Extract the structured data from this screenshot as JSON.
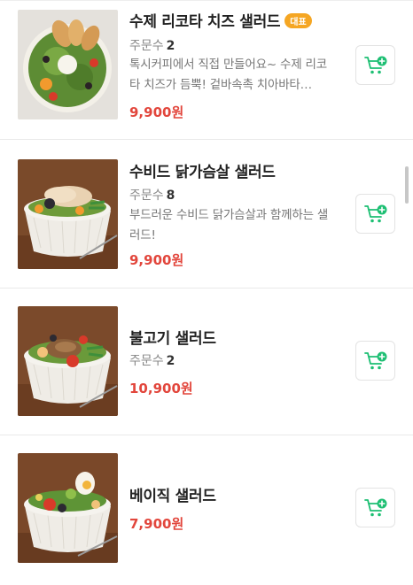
{
  "menu": {
    "order_count_label": "주문수",
    "items": [
      {
        "name": "수제 리코타 치즈 샐러드",
        "badge": "대표",
        "order_count": "2",
        "description": "톡시커피에서 직접 만들어요~ 수제 리코타 치즈가 듬뿍! 겉바속촉 치아바타…",
        "price": "9,900원",
        "image": "ricotta-salad-photo"
      },
      {
        "name": "수비드 닭가슴살 샐러드",
        "order_count": "8",
        "description": "부드러운 수비드 닭가슴살과 함께하는 샐러드!",
        "price": "9,900원",
        "image": "chicken-salad-photo"
      },
      {
        "name": "불고기 샐러드",
        "order_count": "2",
        "price": "10,900원",
        "image": "bulgogi-salad-photo"
      },
      {
        "name": "베이직 샐러드",
        "price": "7,900원",
        "image": "basic-salad-photo"
      }
    ],
    "cart_icon": "add-to-cart-icon"
  },
  "colors": {
    "price": "#e2463c",
    "badge": "#f5a623",
    "cart_icon": "#1dbf73"
  }
}
